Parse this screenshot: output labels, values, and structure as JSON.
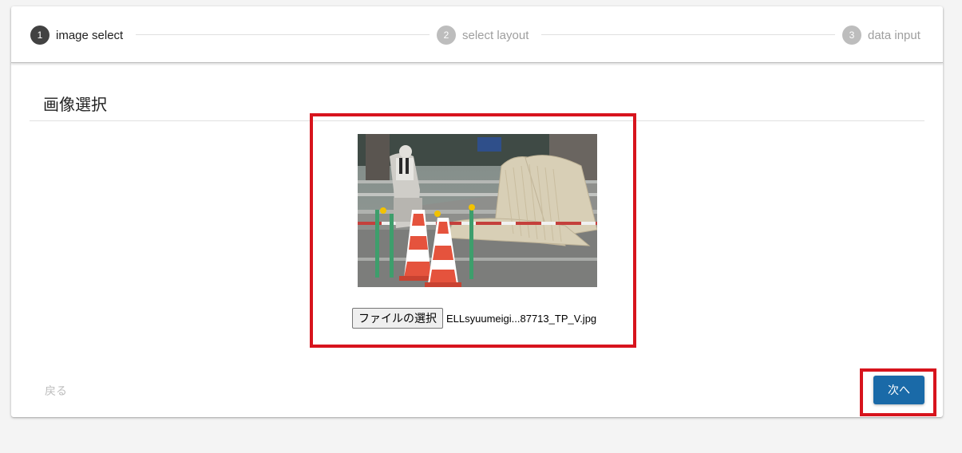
{
  "stepper": {
    "steps": [
      {
        "number": "1",
        "label": "image select",
        "state": "active"
      },
      {
        "number": "2",
        "label": "select layout",
        "state": "inactive"
      },
      {
        "number": "3",
        "label": "data input",
        "state": "inactive"
      }
    ]
  },
  "section": {
    "title": "画像選択"
  },
  "file_input": {
    "button_label": "ファイルの選択",
    "file_name": "ELLsyuumeigi...87713_TP_V.jpg"
  },
  "footer": {
    "back_label": "戻る",
    "next_label": "次へ"
  },
  "colors": {
    "highlight": "#d7141d",
    "primary_button": "#1a6aa8",
    "active_step": "#424242",
    "inactive_step": "#bdbdbd"
  }
}
